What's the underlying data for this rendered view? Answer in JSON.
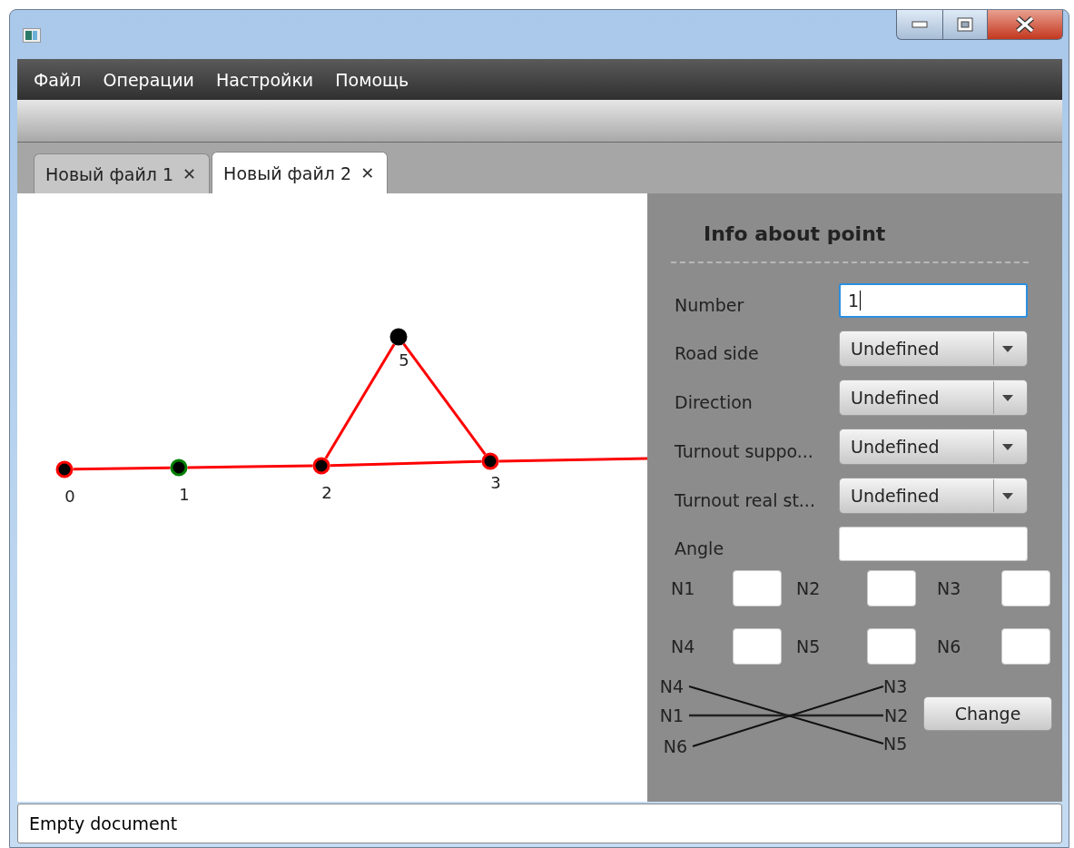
{
  "menu": [
    {
      "label": "Файл"
    },
    {
      "label": "Операции"
    },
    {
      "label": "Настройки"
    },
    {
      "label": "Помощь"
    }
  ],
  "tabs": [
    {
      "label": "Новый файл 1",
      "close": "✕",
      "selected": false
    },
    {
      "label": "Новый файл 2",
      "close": "✕",
      "selected": true
    }
  ],
  "graph": {
    "nodes": [
      {
        "label": "0",
        "color": "#ff0000"
      },
      {
        "label": "1",
        "color": "#008000"
      },
      {
        "label": "2",
        "color": "#ff0000"
      },
      {
        "label": "3",
        "color": "#ff0000"
      },
      {
        "label": "5",
        "color": "#000000"
      }
    ]
  },
  "panel": {
    "title": "Info about point",
    "fields": [
      {
        "label": "Number",
        "kind": "text",
        "value": "1",
        "focused": true
      },
      {
        "label": "Road side",
        "kind": "select",
        "value": "Undefined"
      },
      {
        "label": "Direction",
        "kind": "select",
        "value": "Undefined"
      },
      {
        "label": "Turnout suppo...",
        "kind": "select",
        "value": "Undefined"
      },
      {
        "label": "Turnout real st...",
        "kind": "select",
        "value": "Undefined"
      },
      {
        "label": "Angle",
        "kind": "text",
        "focused": false
      }
    ],
    "neighbors": [
      {
        "label": "N1"
      },
      {
        "label": "N2"
      },
      {
        "label": "N3"
      },
      {
        "label": "N4"
      },
      {
        "label": "N5"
      },
      {
        "label": "N6"
      }
    ],
    "scheme_left": [
      "N4",
      "N1",
      "N6"
    ],
    "scheme_right": [
      "N3",
      "N2",
      "N5"
    ],
    "button": "Change"
  },
  "status_bar": "Empty document"
}
